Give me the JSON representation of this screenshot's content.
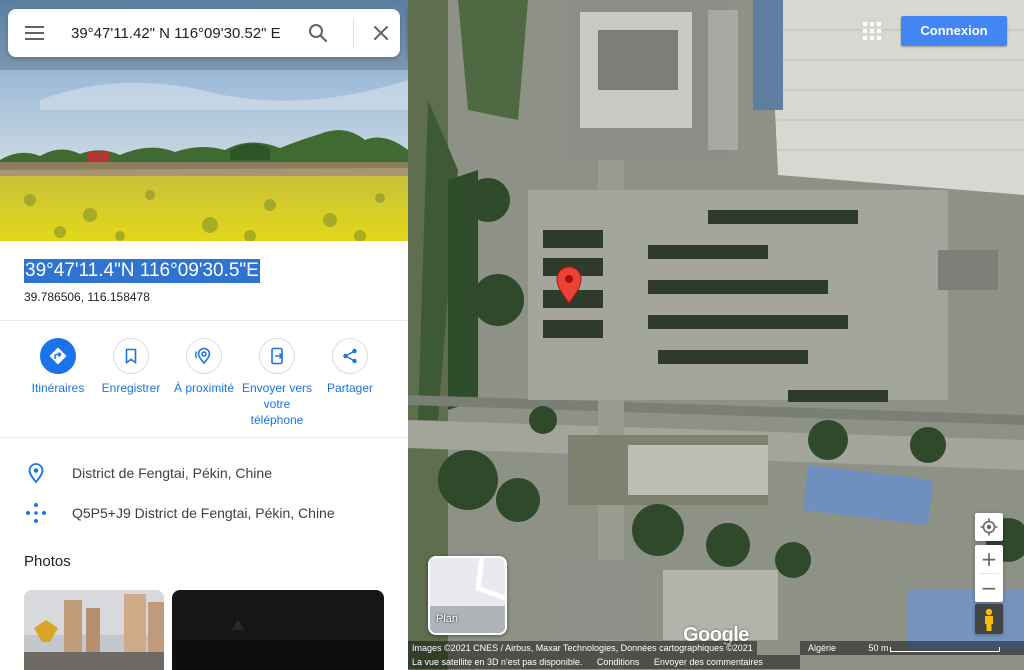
{
  "search": {
    "value": "39°47'11.42\" N 116°09'30.52\" E"
  },
  "place": {
    "title": "39°47'11.4\"N 116°09'30.5\"E",
    "decimal": "39.786506, 116.158478"
  },
  "actions": [
    {
      "label": "Itinéraires",
      "icon": "directions-icon"
    },
    {
      "label": "Enregistrer",
      "icon": "bookmark-icon"
    },
    {
      "label": "À proximité",
      "icon": "nearby-icon"
    },
    {
      "label": "Envoyer vers votre téléphone",
      "icon": "send-to-phone-icon"
    },
    {
      "label": "Partager",
      "icon": "share-icon"
    }
  ],
  "info": {
    "address": "District de Fengtai, Pékin, Chine",
    "plus_code": "Q5P5+J9 District de Fengtai, Pékin, Chine"
  },
  "photos": {
    "title": "Photos"
  },
  "map": {
    "signin_label": "Connexion",
    "layer_label": "Plan",
    "logo": "Google",
    "attribution": "Images ©2021 CNES / Airbus, Maxar Technologies, Données cartographiques ©2021",
    "country": "Algérie",
    "scale": "50 m",
    "notice": "La vue satellite en 3D n'est pas disponible.",
    "conditions": "Conditions",
    "feedback": "Envoyer des commentaires"
  },
  "colors": {
    "accent": "#1a73e8",
    "signin": "#4285f4",
    "pin": "#ea4335",
    "selection": "#2f74d0"
  }
}
